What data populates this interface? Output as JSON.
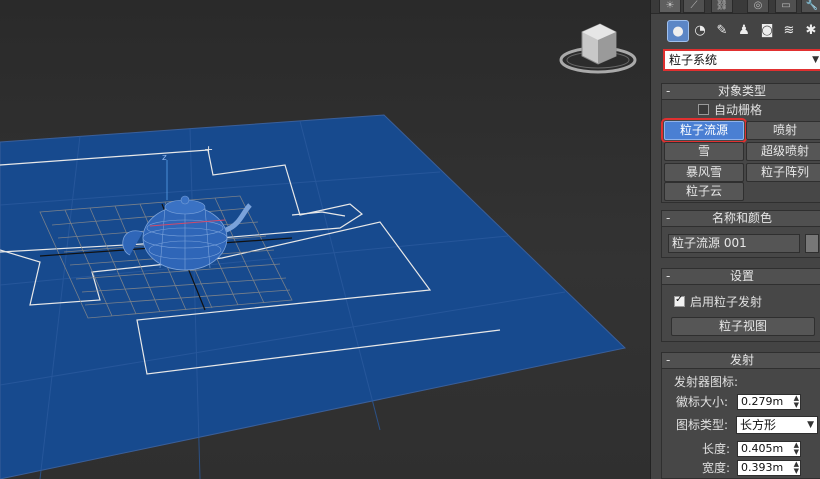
{
  "panel": {
    "tabs": [
      "☀",
      "⟋",
      "⛓",
      "◎",
      "▭",
      "🔧"
    ],
    "icon_buttons": [
      {
        "icon": "geometry-icon",
        "glyph": "●"
      },
      {
        "icon": "shapes-icon",
        "glyph": "◔"
      },
      {
        "icon": "lights-icon",
        "glyph": "✎"
      },
      {
        "icon": "cameras-icon",
        "glyph": "♟"
      },
      {
        "icon": "helpers-icon",
        "glyph": "◙"
      },
      {
        "icon": "spacewarps-icon",
        "glyph": "≋"
      },
      {
        "icon": "systems-icon",
        "glyph": "✱"
      }
    ],
    "category_dropdown": "粒子系统",
    "object_type": {
      "title": "对象类型",
      "autogrid_label": "自动栅格",
      "buttons": [
        "粒子流源",
        "喷射",
        "雪",
        "超级喷射",
        "暴风雪",
        "粒子阵列",
        "粒子云"
      ]
    },
    "name_color": {
      "title": "名称和颜色",
      "name_value": "粒子流源 001"
    },
    "setup": {
      "title": "设置",
      "enable_label": "启用粒子发射",
      "view_button": "粒子视图"
    },
    "emission": {
      "title": "发射",
      "group_label": "发射器图标:",
      "logo_size_label": "徽标大小:",
      "logo_size_value": "0.279m",
      "icon_type_label": "图标类型:",
      "icon_type_value": "长方形",
      "length_label": "长度:",
      "length_value": "0.405m",
      "width_label": "宽度:",
      "width_value": "0.393m"
    }
  },
  "colors": {
    "ground_plane": "#174a8e",
    "active_button": "#4a7fd3",
    "highlight": "#e03030"
  }
}
